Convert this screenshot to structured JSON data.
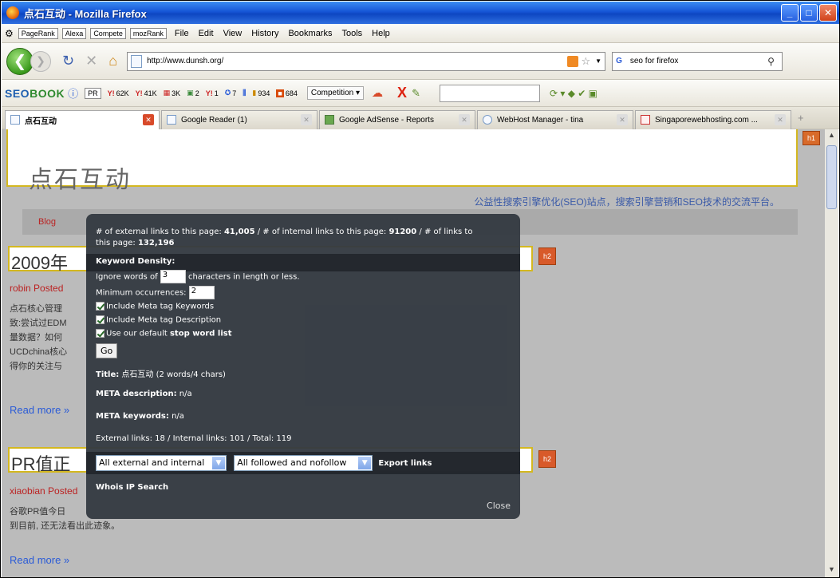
{
  "window": {
    "title": "点石互动 - Mozilla Firefox"
  },
  "menubar": {
    "seo_tools": [
      "PageRank",
      "Alexa",
      "Compete",
      "mozRank"
    ],
    "menus": [
      "File",
      "Edit",
      "View",
      "History",
      "Bookmarks",
      "Tools",
      "Help"
    ]
  },
  "navbar": {
    "url": "http://www.dunsh.org/",
    "search_value": "seo for firefox"
  },
  "seobar": {
    "logo_a": "SEO",
    "logo_b": "BOOK",
    "stats": [
      "62K",
      "41K",
      "3K",
      "2",
      "1",
      "7",
      "934",
      "684"
    ],
    "competition_label": "Competition"
  },
  "tabs": [
    {
      "label": "点石互动",
      "active": true
    },
    {
      "label": "Google Reader (1)",
      "active": false
    },
    {
      "label": "Google AdSense - Reports",
      "active": false
    },
    {
      "label": "WebHost Manager - tina",
      "active": false
    },
    {
      "label": "Singaporewebhosting.com ...",
      "active": false
    }
  ],
  "site": {
    "name": "点石互动",
    "h1": "h1",
    "tagline": "公益性搜索引擎优化(SEO)站点，搜索引擎营销和SEO技术的交流平台。",
    "nav_blog": "Blog"
  },
  "posts": [
    {
      "title": "2009年",
      "author": "robin Posted",
      "lines": [
        "点石核心管理",
        "致:尝试过EDM",
        "量数据？如何",
        "UCDchina核心",
        "得你的关注与"
      ],
      "readmore": "Read more »",
      "badge": "h2"
    },
    {
      "title": "PR值正",
      "author": "xiaobian Posted",
      "lines": [
        "谷歌PR值今日",
        "到目前, 还无法看出此迹象。"
      ],
      "readmore": "Read more »",
      "badge": "h2"
    }
  ],
  "overlay": {
    "links_pre": "# of external links to this page: ",
    "external_count": "41,005",
    "links_mid": " / # of internal links to this page: ",
    "internal_count": "91200",
    "links_mid2": " / # of links to",
    "links_line2_pre": "this page: ",
    "total_count": "132,196",
    "keyword_density": "Keyword Density:",
    "ignore_pre": "Ignore words of",
    "ignore_value": "3",
    "ignore_post": "characters in length or less.",
    "min_occ_label": "Minimum occurrences:",
    "min_occ_value": "2",
    "check_keywords": "Include Meta tag Keywords",
    "check_description": "Include Meta tag Description",
    "check_stopword_pre": "Use our default ",
    "check_stopword_bold": "stop word list",
    "go": "Go",
    "title_label": "Title:",
    "title_value": " 点石互动 (2 words/4 chars)",
    "meta_desc_label": "META description:",
    "meta_desc_value": " n/a",
    "meta_kw_label": "META keywords:",
    "meta_kw_value": " n/a",
    "link_summary": "External links: 18 / Internal links: 101 / Total: 119",
    "select1": "All external and internal",
    "select2": "All followed and nofollow",
    "export": "Export links",
    "whois": "Whois IP Search",
    "close": "Close"
  },
  "colors": {
    "accent_green": "#3a9a1c",
    "title_blue": "#1656d6",
    "overlay_bg": "#343a42",
    "badge_orange": "#d85a2a"
  }
}
